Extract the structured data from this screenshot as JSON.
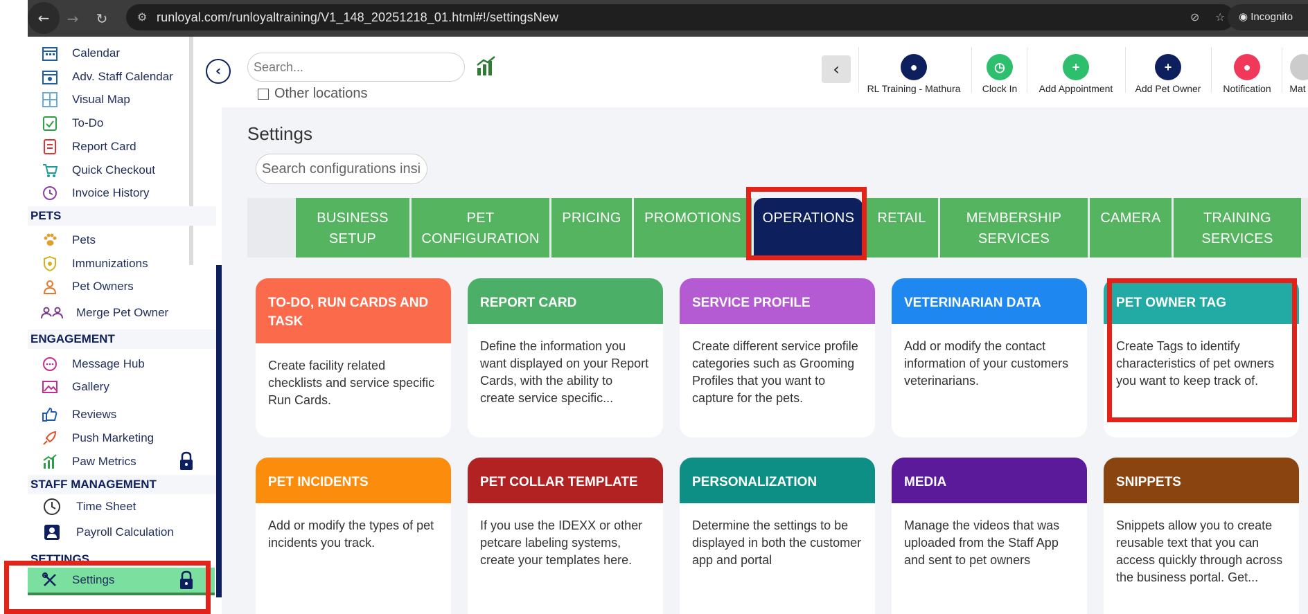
{
  "browser": {
    "url": "runloyal.com/runloyaltraining/V1_148_20251218_01.html#!/settingsNew",
    "incognito_label": "Incognito"
  },
  "sidebar": {
    "items_top": [
      {
        "label": "Calendar",
        "icon": "calendar-icon"
      },
      {
        "label": "Adv. Staff Calendar",
        "icon": "staff-calendar-icon"
      },
      {
        "label": "Visual Map",
        "icon": "map-icon"
      },
      {
        "label": "To-Do",
        "icon": "todo-icon"
      },
      {
        "label": "Report Card",
        "icon": "report-card-icon"
      },
      {
        "label": "Quick Checkout",
        "icon": "cart-icon"
      },
      {
        "label": "Invoice History",
        "icon": "invoice-history-icon"
      }
    ],
    "section_pets": "PETS",
    "pets_items": [
      {
        "label": "Pets",
        "icon": "paw-icon"
      },
      {
        "label": "Immunizations",
        "icon": "shield-icon"
      },
      {
        "label": "Pet Owners",
        "icon": "person-icon"
      },
      {
        "label": "Merge Pet Owner",
        "icon": "merge-people-icon"
      }
    ],
    "section_engagement": "ENGAGEMENT",
    "engagement_items": [
      {
        "label": "Message Hub",
        "icon": "chat-icon"
      },
      {
        "label": "Gallery",
        "icon": "image-icon"
      },
      {
        "label": "Reviews",
        "icon": "thumbs-up-icon"
      },
      {
        "label": "Push Marketing",
        "icon": "rocket-icon"
      },
      {
        "label": "Paw Metrics",
        "icon": "chart-icon"
      }
    ],
    "section_staff": "STAFF MANAGEMENT",
    "staff_items": [
      {
        "label": "Time Sheet",
        "icon": "clock-icon"
      },
      {
        "label": "Payroll Calculation",
        "icon": "payroll-icon"
      }
    ],
    "section_settings": "SETTINGS",
    "settings_item": {
      "label": "Settings",
      "icon": "tools-icon"
    }
  },
  "topbar": {
    "search_placeholder": "Search...",
    "other_locations": "Other locations",
    "tools": [
      {
        "label": "RL Training - Mathura",
        "color": "#0d1f5c"
      },
      {
        "label": "Clock In",
        "color": "#2ebf6e"
      },
      {
        "label": "Add Appointment",
        "color": "#2ebf6e"
      },
      {
        "label": "Add Pet Owner",
        "color": "#0d1f5c"
      },
      {
        "label": "Notification",
        "color": "#f0385a"
      },
      {
        "label": "Mat",
        "color": "#cccccc"
      }
    ]
  },
  "page": {
    "title": "Settings",
    "config_search_placeholder": "Search configurations insi"
  },
  "tabs": [
    {
      "line1": "BUSINESS",
      "line2": "SETUP"
    },
    {
      "line1": "PET",
      "line2": "CONFIGURATION"
    },
    {
      "line1": "PRICING",
      "line2": ""
    },
    {
      "line1": "PROMOTIONS",
      "line2": ""
    },
    {
      "line1": "OPERATIONS",
      "line2": "",
      "active": true
    },
    {
      "line1": "RETAIL",
      "line2": ""
    },
    {
      "line1": "MEMBERSHIP",
      "line2": "SERVICES"
    },
    {
      "line1": "CAMERA",
      "line2": ""
    },
    {
      "line1": "TRAINING",
      "line2": "SERVICES"
    }
  ],
  "cards": [
    {
      "title": "TO-DO, RUN CARDS AND TASK",
      "color": "#fb6a4a",
      "body": "Create facility related checklists and service specific Run Cards."
    },
    {
      "title": "REPORT CARD",
      "color": "#4caf68",
      "body": "Define the information you want displayed on your Report Cards, with the ability to create service specific..."
    },
    {
      "title": "SERVICE PROFILE",
      "color": "#b45bd3",
      "body": "Create different service profile categories such as Grooming Profiles that you want to capture for the pets."
    },
    {
      "title": "VETERINARIAN DATA",
      "color": "#1e88f0",
      "body": "Add or modify the contact information of your customers veterinarians."
    },
    {
      "title": "PET OWNER TAG",
      "color": "#22aaa5",
      "body": "Create Tags to identify characteristics of pet owners you want to keep track of."
    },
    {
      "title": "PET INCIDENTS",
      "color": "#fb8c0c",
      "body": "Add or modify the types of pet incidents you track."
    },
    {
      "title": "PET COLLAR TEMPLATE",
      "color": "#b22222",
      "body": "If you use the IDEXX or other petcare labeling systems, create your templates here."
    },
    {
      "title": "PERSONALIZATION",
      "color": "#0e8f86",
      "body": "Determine the settings to be displayed in both the customer app and portal"
    },
    {
      "title": "MEDIA",
      "color": "#5a1a9a",
      "body": "Manage the videos that was uploaded from the Staff App and sent to pet owners"
    },
    {
      "title": "SNIPPETS",
      "color": "#8a4410",
      "body": "Snippets allow you to create reusable text that you can access quickly through across the business portal. Get..."
    }
  ]
}
